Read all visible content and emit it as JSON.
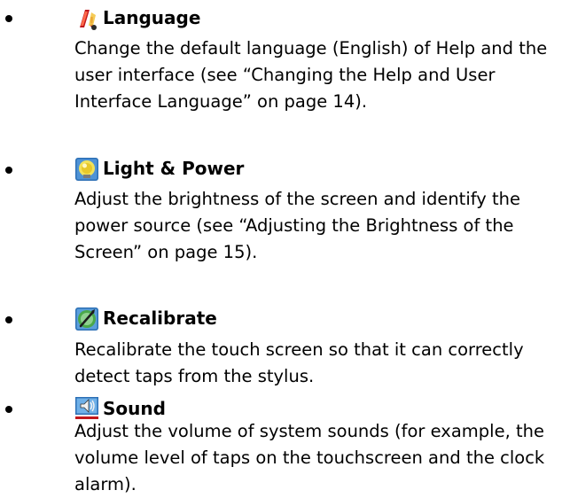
{
  "items": [
    {
      "icon": "language-icon",
      "title": "Language",
      "lines": [
        "Change the default language (English) of Help and the",
        "user interface (see “Changing the Help and User",
        "Interface Language” on page 14)."
      ]
    },
    {
      "icon": "light-bulb-icon",
      "title": "Light & Power",
      "lines": [
        "Adjust the brightness of the screen and identify the",
        "power source (see “Adjusting the Brightness of the",
        "Screen” on page 15)."
      ]
    },
    {
      "icon": "recalibrate-icon",
      "title": "Recalibrate",
      "lines": [
        "Recalibrate the touch screen so that it can correctly",
        "detect taps from the stylus."
      ]
    },
    {
      "icon": "speaker-icon",
      "title": "Sound",
      "lines": [
        "Adjust the volume of system sounds (for example, the",
        "volume level of taps on the touchscreen and the clock",
        "alarm)."
      ]
    }
  ]
}
